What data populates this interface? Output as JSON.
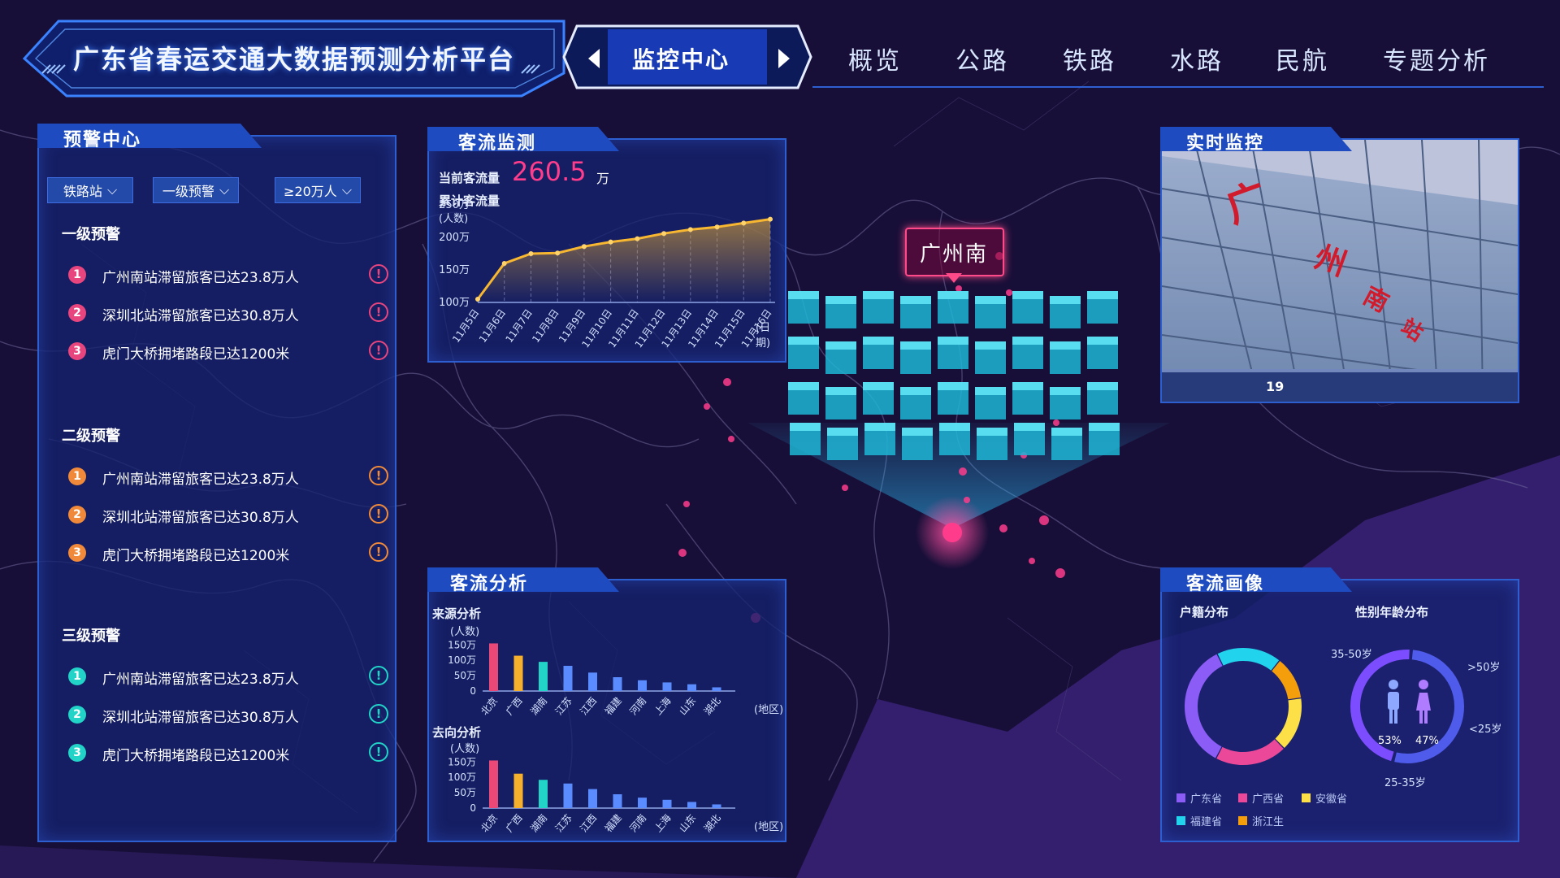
{
  "header": {
    "platform_title": "广东省春运交通大数据预测分析平台",
    "current_tab": "监控中心",
    "nav_items": [
      "概览",
      "公路",
      "铁路",
      "水路",
      "民航",
      "专题分析"
    ]
  },
  "warning_center": {
    "title": "预警中心",
    "filters": [
      "铁路站",
      "一级预警",
      "≥20万人"
    ],
    "levels": [
      {
        "heading": "一级预警",
        "color": "#e8457e",
        "items": [
          "广州南站滞留旅客已达23.8万人",
          "深圳北站滞留旅客已达30.8万人",
          "虎门大桥拥堵路段已达1200米"
        ]
      },
      {
        "heading": "二级预警",
        "color": "#f08a3a",
        "items": [
          "广州南站滞留旅客已达23.8万人",
          "深圳北站滞留旅客已达30.8万人",
          "虎门大桥拥堵路段已达1200米"
        ]
      },
      {
        "heading": "三级预警",
        "color": "#22d3c8",
        "items": [
          "广州南站滞留旅客已达23.8万人",
          "深圳北站滞留旅客已达30.8万人",
          "虎门大桥拥堵路段已达1200米"
        ]
      }
    ],
    "badge_numbers": [
      "1",
      "2",
      "3"
    ],
    "warn_glyph": "!"
  },
  "flow_monitor": {
    "title": "客流监测",
    "current_label": "当前客流量",
    "current_value": "260.5",
    "current_unit": "万",
    "cumulative_label": "累计客流量",
    "y_unit": "(人数)",
    "x_unit": "(日期)"
  },
  "realtime": {
    "title": "实时监控",
    "sign_chars": [
      "广",
      "州",
      "南",
      "站"
    ],
    "gate_label": "19"
  },
  "map": {
    "station_label": "广州南"
  },
  "flow_analysis": {
    "title": "客流分析",
    "source_label": "来源分析",
    "dest_label": "去向分析",
    "y_unit": "(人数)",
    "x_unit": "(地区)"
  },
  "portrait": {
    "title": "客流画像",
    "household_label": "户籍分布",
    "gender_age_label": "性别年龄分布",
    "age_labels": [
      "35-50岁",
      ">50岁",
      "<25岁",
      "25-35岁"
    ],
    "male_pct": "53%",
    "female_pct": "47%",
    "legend": [
      {
        "name": "广东省",
        "color": "#8b5cf6"
      },
      {
        "name": "广西省",
        "color": "#ec4899"
      },
      {
        "name": "安徽省",
        "color": "#fde047"
      },
      {
        "name": "福建省",
        "color": "#22d3ee"
      },
      {
        "name": "浙江生",
        "color": "#f59e0b"
      }
    ]
  },
  "chart_data": [
    {
      "type": "area",
      "title": "累计客流量",
      "xlabel": "(日期)",
      "ylabel": "(人数)",
      "categories": [
        "11月5日",
        "11月6日",
        "11月7日",
        "11月8日",
        "11月9日",
        "11月10日",
        "11月11日",
        "11月12日",
        "11月13日",
        "11月14日",
        "11月15日",
        "11月16日"
      ],
      "y_ticks": [
        "250万",
        "200万",
        "150万",
        "100万"
      ],
      "values": [
        105,
        160,
        175,
        176,
        186,
        193,
        198,
        206,
        212,
        216,
        222,
        228
      ],
      "ylim": [
        100,
        250
      ],
      "color": "#f7b731"
    },
    {
      "type": "bar",
      "title": "来源分析",
      "xlabel": "(地区)",
      "ylabel": "(人数)",
      "categories": [
        "北京",
        "广西",
        "湖南",
        "江苏",
        "江西",
        "福建",
        "河南",
        "上海",
        "山东",
        "湖北"
      ],
      "y_ticks": [
        "150万",
        "100万",
        "50万",
        "0"
      ],
      "values": [
        155,
        115,
        95,
        82,
        60,
        45,
        35,
        28,
        22,
        12
      ],
      "ylim": [
        0,
        180
      ],
      "colors": [
        "#ec4877",
        "#f6b02c",
        "#22d3c8",
        "#5b8cff",
        "#5b8cff",
        "#5b8cff",
        "#5b8cff",
        "#5b8cff",
        "#5b8cff",
        "#5b8cff"
      ]
    },
    {
      "type": "bar",
      "title": "去向分析",
      "xlabel": "(地区)",
      "ylabel": "(人数)",
      "categories": [
        "北京",
        "广西",
        "湖南",
        "江苏",
        "江西",
        "福建",
        "河南",
        "上海",
        "山东",
        "湖北"
      ],
      "y_ticks": [
        "150万",
        "100万",
        "50万",
        "0"
      ],
      "values": [
        155,
        112,
        92,
        80,
        62,
        45,
        34,
        27,
        20,
        12
      ],
      "ylim": [
        0,
        180
      ],
      "colors": [
        "#ec4877",
        "#f6b02c",
        "#22d3c8",
        "#5b8cff",
        "#5b8cff",
        "#5b8cff",
        "#5b8cff",
        "#5b8cff",
        "#5b8cff",
        "#5b8cff"
      ]
    },
    {
      "type": "pie",
      "title": "户籍分布",
      "categories": [
        "广东省",
        "广西省",
        "安徽省",
        "福建省",
        "浙江生"
      ],
      "values": [
        35,
        20,
        15,
        18,
        12
      ]
    },
    {
      "type": "pie",
      "title": "性别年龄分布",
      "categories": [
        "男",
        "女"
      ],
      "values": [
        53,
        47
      ]
    }
  ]
}
